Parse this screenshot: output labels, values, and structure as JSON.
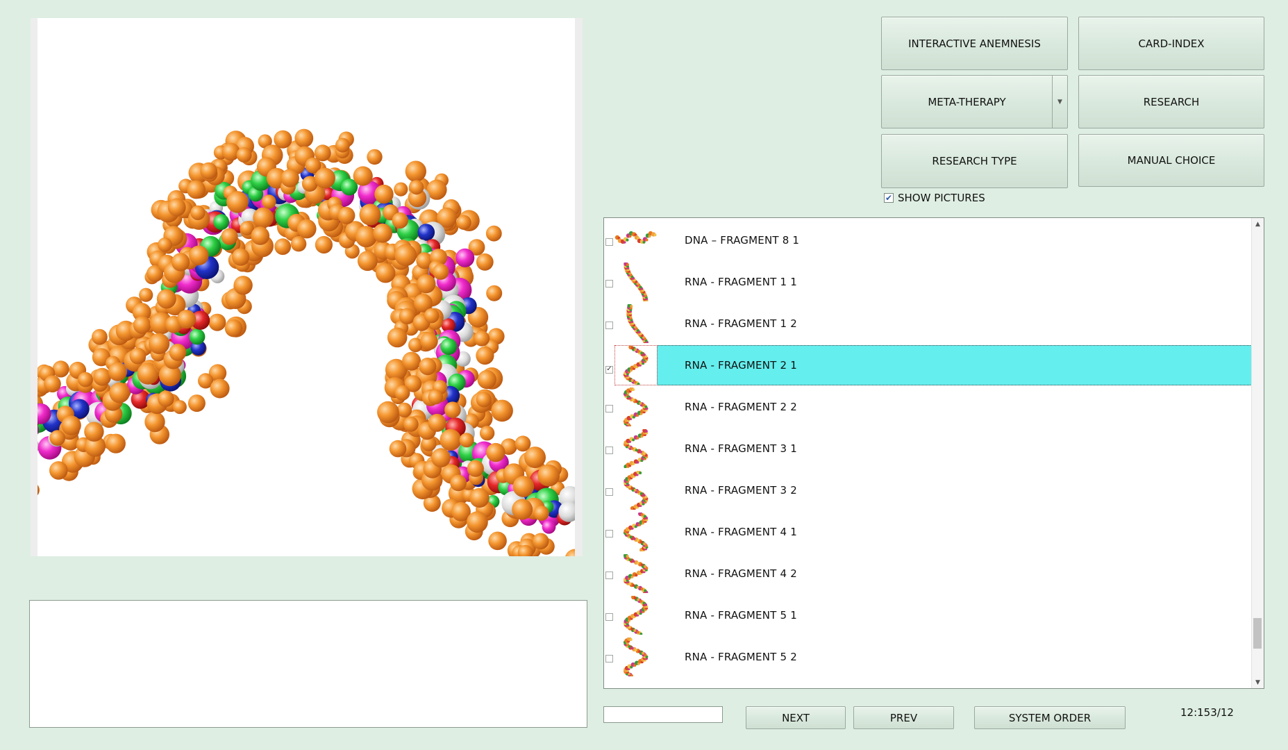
{
  "buttons": {
    "interactive_anemnesis": "INTERACTIVE ANEMNESIS",
    "card_index": "CARD-INDEX",
    "meta_therapy": "META-THERAPY",
    "research": "RESEARCH",
    "research_type": "RESEARCH TYPE",
    "manual_choice": "MANUAL CHOICE"
  },
  "show_pictures": {
    "label": "SHOW PICTURES",
    "checked": true
  },
  "list": {
    "items": [
      {
        "label": "DNA – FRAGMENT  8  1",
        "checked": false,
        "selected": false
      },
      {
        "label": "RNA - FRAGMENT  1  1",
        "checked": false,
        "selected": false
      },
      {
        "label": "RNA - FRAGMENT  1  2",
        "checked": false,
        "selected": false
      },
      {
        "label": "RNA - FRAGMENT  2  1",
        "checked": true,
        "selected": true
      },
      {
        "label": "RNA - FRAGMENT  2  2",
        "checked": false,
        "selected": false
      },
      {
        "label": "RNA - FRAGMENT  3  1",
        "checked": false,
        "selected": false
      },
      {
        "label": "RNA - FRAGMENT  3  2",
        "checked": false,
        "selected": false
      },
      {
        "label": "RNA - FRAGMENT  4  1",
        "checked": false,
        "selected": false
      },
      {
        "label": "RNA - FRAGMENT  4  2",
        "checked": false,
        "selected": false
      },
      {
        "label": "RNA - FRAGMENT  5  1",
        "checked": false,
        "selected": false
      },
      {
        "label": "RNA - FRAGMENT  5  2",
        "checked": false,
        "selected": false
      }
    ]
  },
  "nav": {
    "next": "NEXT",
    "prev": "PREV",
    "system_order": "SYSTEM ORDER"
  },
  "search": {
    "value": ""
  },
  "counter": "12:153/12",
  "colors": {
    "background": "#deeee3",
    "selection": "#64eeee",
    "orange": "#f08a2c",
    "magenta": "#f020c8",
    "green": "#22c43a",
    "blue": "#1c2bb8",
    "red": "#e02020",
    "white_atom": "#d8d8d8"
  }
}
